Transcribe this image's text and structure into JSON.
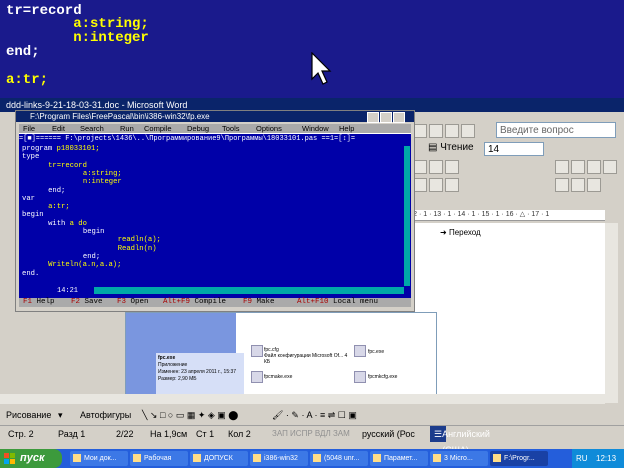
{
  "slide": {
    "lines": [
      "tr=record",
      "        a:string;",
      "        n:integer",
      "end;",
      "a:tr;"
    ]
  },
  "word": {
    "title": "ddd-links-9-21-18-03-31.doc - Microsoft Word",
    "ask_placeholder": "Введите вопрос",
    "read_label": "Чтение",
    "font_size": "14",
    "ruler": "· 12 · 1 · 13 · 1 · 14 · 1 · 15 · 1 · 16 · △ · 17 · 1",
    "nav_go": "Переход",
    "file_items": [
      "fpc.exe",
      "fpcmake.exe",
      "fpc.cfg",
      "fpcmkcfg.exe"
    ],
    "file_info": [
      "fpc.exe",
      "Приложение",
      "Изменен: 23 апреля 2011 г., 15:37",
      "Размер: 2,90 МБ"
    ],
    "cfg_desc": "Файл конфигурации Microsoft Of... 4 КБ",
    "draw_label": "Рисование",
    "autoshapes_label": "Автофигуры",
    "status": {
      "page": "Стр. 2",
      "section": "Разд 1",
      "pages": "2/22",
      "at": "На 1,9см",
      "line": "Ст 1",
      "col": "Кол 2",
      "modes": "ЗАП  ИСПР  ВДЛ  ЗАМ",
      "lang": "русский (Рос",
      "lang_tag": "Английский (США)"
    }
  },
  "ide": {
    "title": "F:\\Program Files\\FreePascal\\bin\\i386-win32\\fp.exe",
    "frame": "=[■]====== F:\\projects\\1436\\..\\Программирование9\\Программы\\18033101.pas ==1=[↕]=",
    "menu": [
      "File",
      "Edit",
      "Search",
      "Run",
      "Compile",
      "Debug",
      "Tools",
      "Options",
      "Window",
      "Help"
    ],
    "code": [
      {
        "indent": 0,
        "text": "program p18033101;",
        "kw": "program",
        "rest": " p18033101;"
      },
      {
        "indent": 0,
        "text": "type",
        "kw": "type",
        "rest": ""
      },
      {
        "indent": 6,
        "text": "tr=record",
        "kw": "",
        "rest": "tr=record"
      },
      {
        "indent": 14,
        "text": "a:string;",
        "kw": "",
        "rest": "a:string;"
      },
      {
        "indent": 14,
        "text": "n:integer",
        "kw": "",
        "rest": "n:integer"
      },
      {
        "indent": 6,
        "text": "end;",
        "kw": "end;",
        "rest": ""
      },
      {
        "indent": 0,
        "text": "var",
        "kw": "var",
        "rest": ""
      },
      {
        "indent": 6,
        "text": "a:tr;",
        "kw": "",
        "rest": "a:tr;"
      },
      {
        "indent": 0,
        "text": "begin",
        "kw": "begin",
        "rest": ""
      },
      {
        "indent": 6,
        "text": "with a do",
        "kw": "with",
        "rest": " a do"
      },
      {
        "indent": 14,
        "text": "begin",
        "kw": "begin",
        "rest": ""
      },
      {
        "indent": 22,
        "text": "readln(a);",
        "kw": "",
        "rest": "readln(a);"
      },
      {
        "indent": 22,
        "text": "Readln(n)",
        "kw": "",
        "rest": "Readln(n)"
      },
      {
        "indent": 14,
        "text": "end;",
        "kw": "end;",
        "rest": ""
      },
      {
        "indent": 6,
        "text": "Writeln(a.n,a.a);",
        "kw": "",
        "rest": "Writeln(a.n,a.a);"
      },
      {
        "indent": 0,
        "text": "end.",
        "kw": "end.",
        "rest": ""
      }
    ],
    "cursor_pos": "14:21",
    "status": [
      {
        "key": "F1",
        "label": "Help"
      },
      {
        "key": "F2",
        "label": "Save"
      },
      {
        "key": "F3",
        "label": "Open"
      },
      {
        "key": "Alt+F9",
        "label": "Compile"
      },
      {
        "key": "F9",
        "label": "Make"
      },
      {
        "key": "Alt+F10",
        "label": "Local menu"
      }
    ]
  },
  "taskbar": {
    "start": "пуск",
    "tasks": [
      "Мои док...",
      "Рабочая",
      "ДОПУСК",
      "i386-win32",
      "(5048 unr...",
      "Парамет...",
      "3 Micro...",
      "F:\\Progr..."
    ],
    "clock": "12:13",
    "lang": "RU"
  }
}
